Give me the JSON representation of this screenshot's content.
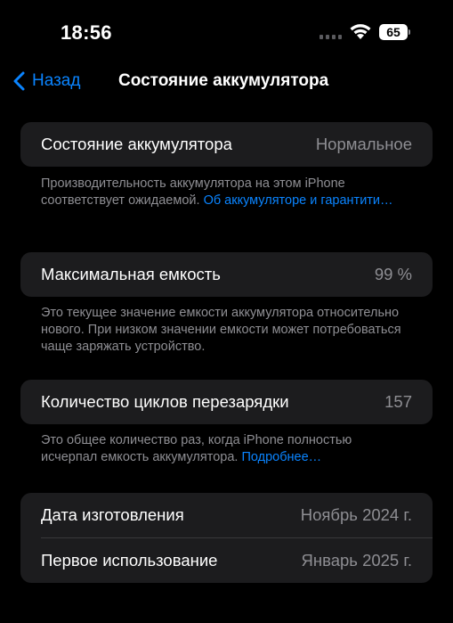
{
  "status_bar": {
    "time": "18:56",
    "battery_level": "65"
  },
  "nav": {
    "back_label": "Назад",
    "title": "Состояние аккумулятора"
  },
  "battery_health": {
    "label": "Состояние аккумулятора",
    "value": "Нормальное",
    "footnote_text": "Производительность аккумулятора на этом iPhone соответствует ожидаемой. ",
    "footnote_link": "Об аккумуляторе и гаранти­ти…"
  },
  "max_capacity": {
    "label": "Максимальная емкость",
    "value": "99 %",
    "footnote": "Это текущее значение емкости аккумулятора относительно нового. При низком значении емкости может потребоваться чаще заряжать устройство."
  },
  "cycle_count": {
    "label": "Количество циклов перезарядки",
    "value": "157",
    "footnote_text": "Это общее количество раз, когда iPhone полностью исчерпал емкость аккумулятора. ",
    "footnote_link": "Подробнее…"
  },
  "dates": {
    "manufacture_label": "Дата изготовления",
    "manufacture_value": "Ноябрь 2024 г.",
    "first_use_label": "Первое использование",
    "first_use_value": "Январь 2025 г."
  },
  "colors": {
    "accent": "#0a84ff",
    "background": "#000000",
    "card": "#1c1c1e",
    "secondary_text": "#8e8e93"
  }
}
